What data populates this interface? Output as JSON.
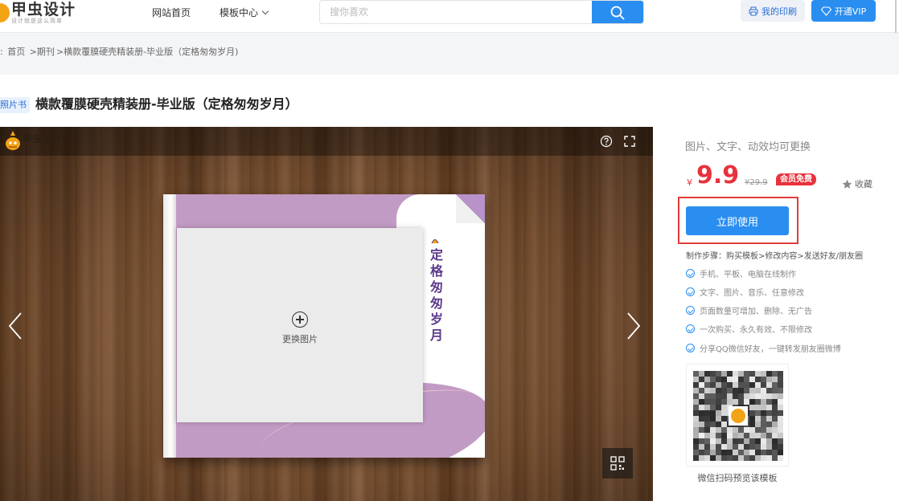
{
  "header": {
    "logo_text": "甲虫设计",
    "logo_sub": "设计就是这么简单",
    "nav": [
      {
        "label": "网站首页"
      },
      {
        "label": "模板中心"
      }
    ],
    "search": {
      "placeholder": "搜你喜欢",
      "value": ""
    },
    "print_label": "我的印刷",
    "vip_label": "开通VIP",
    "accent": "#2a8ef0"
  },
  "breadcrumb": {
    "prefix": ":",
    "items": [
      "首页",
      ">期刊",
      ">横款覆膜硬壳精装册-毕业版（定格匆匆岁月)"
    ]
  },
  "product": {
    "tag": "照片书",
    "title": "横款覆膜硬壳精装册-毕业版（定格匆匆岁月）",
    "tagline": "图片、文字、动效均可更换",
    "price_symbol": "¥",
    "price": "9.9",
    "old_price": "¥29.9",
    "vip_badge": "会员免费",
    "favorite_label": "收藏",
    "use_button": "立即使用",
    "steps": "制作步骤：购买模板>修改内容>发送好友/朋友圈",
    "features": [
      "手机、平板、电脑在线制作",
      "文字、图片、音乐、任意修改",
      "页面数量可增加、删除、无广告",
      "一次购买、永久有效、不限修改",
      "分享QQ微信好友，一键转发朋友圈微博"
    ],
    "qr_caption": "微信扫码预览该模板",
    "price_color": "#e8323c"
  },
  "preview": {
    "replace_image_label": "更换图片",
    "book_title": "定格匆匆岁月",
    "brand_logo_text": "甲虫设计"
  }
}
